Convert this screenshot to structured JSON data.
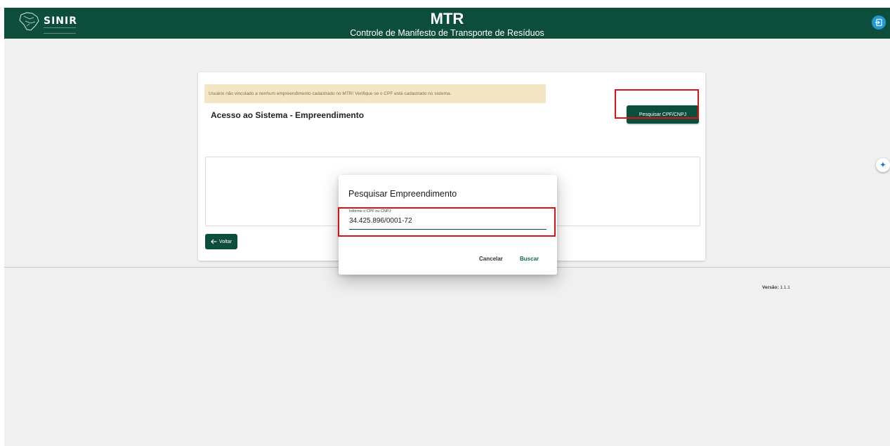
{
  "header": {
    "brand": "SINIR",
    "title": "MTR",
    "subtitle": "Controle de Manifesto de Transporte de Resíduos",
    "exit_icon": "exit-icon",
    "color": "#0c4d3c"
  },
  "card": {
    "alert_text": "Usuário não vinculado a nenhum empreendimento cadastrado no MTR! Verifique se o CPF está cadastrado no sistema.",
    "title": "Acesso ao Sistema - Empreendimento",
    "search_button": "Pesquisar CPF/CNPJ",
    "back_button": "Voltar"
  },
  "footer": {
    "version_label": "Versão:",
    "version_value": "1.1.1"
  },
  "dialog": {
    "title": "Pesquisar Empreendimento",
    "field_label": "Informe o CPF ou CNPJ:",
    "field_value": "34.425.896/0001-72",
    "cancel": "Cancelar",
    "search": "Buscar"
  },
  "colors": {
    "primary": "#0c4d3c",
    "alert_bg": "#f2e6c4",
    "highlight": "#e01010",
    "exit_button": "#1e9bd6"
  }
}
